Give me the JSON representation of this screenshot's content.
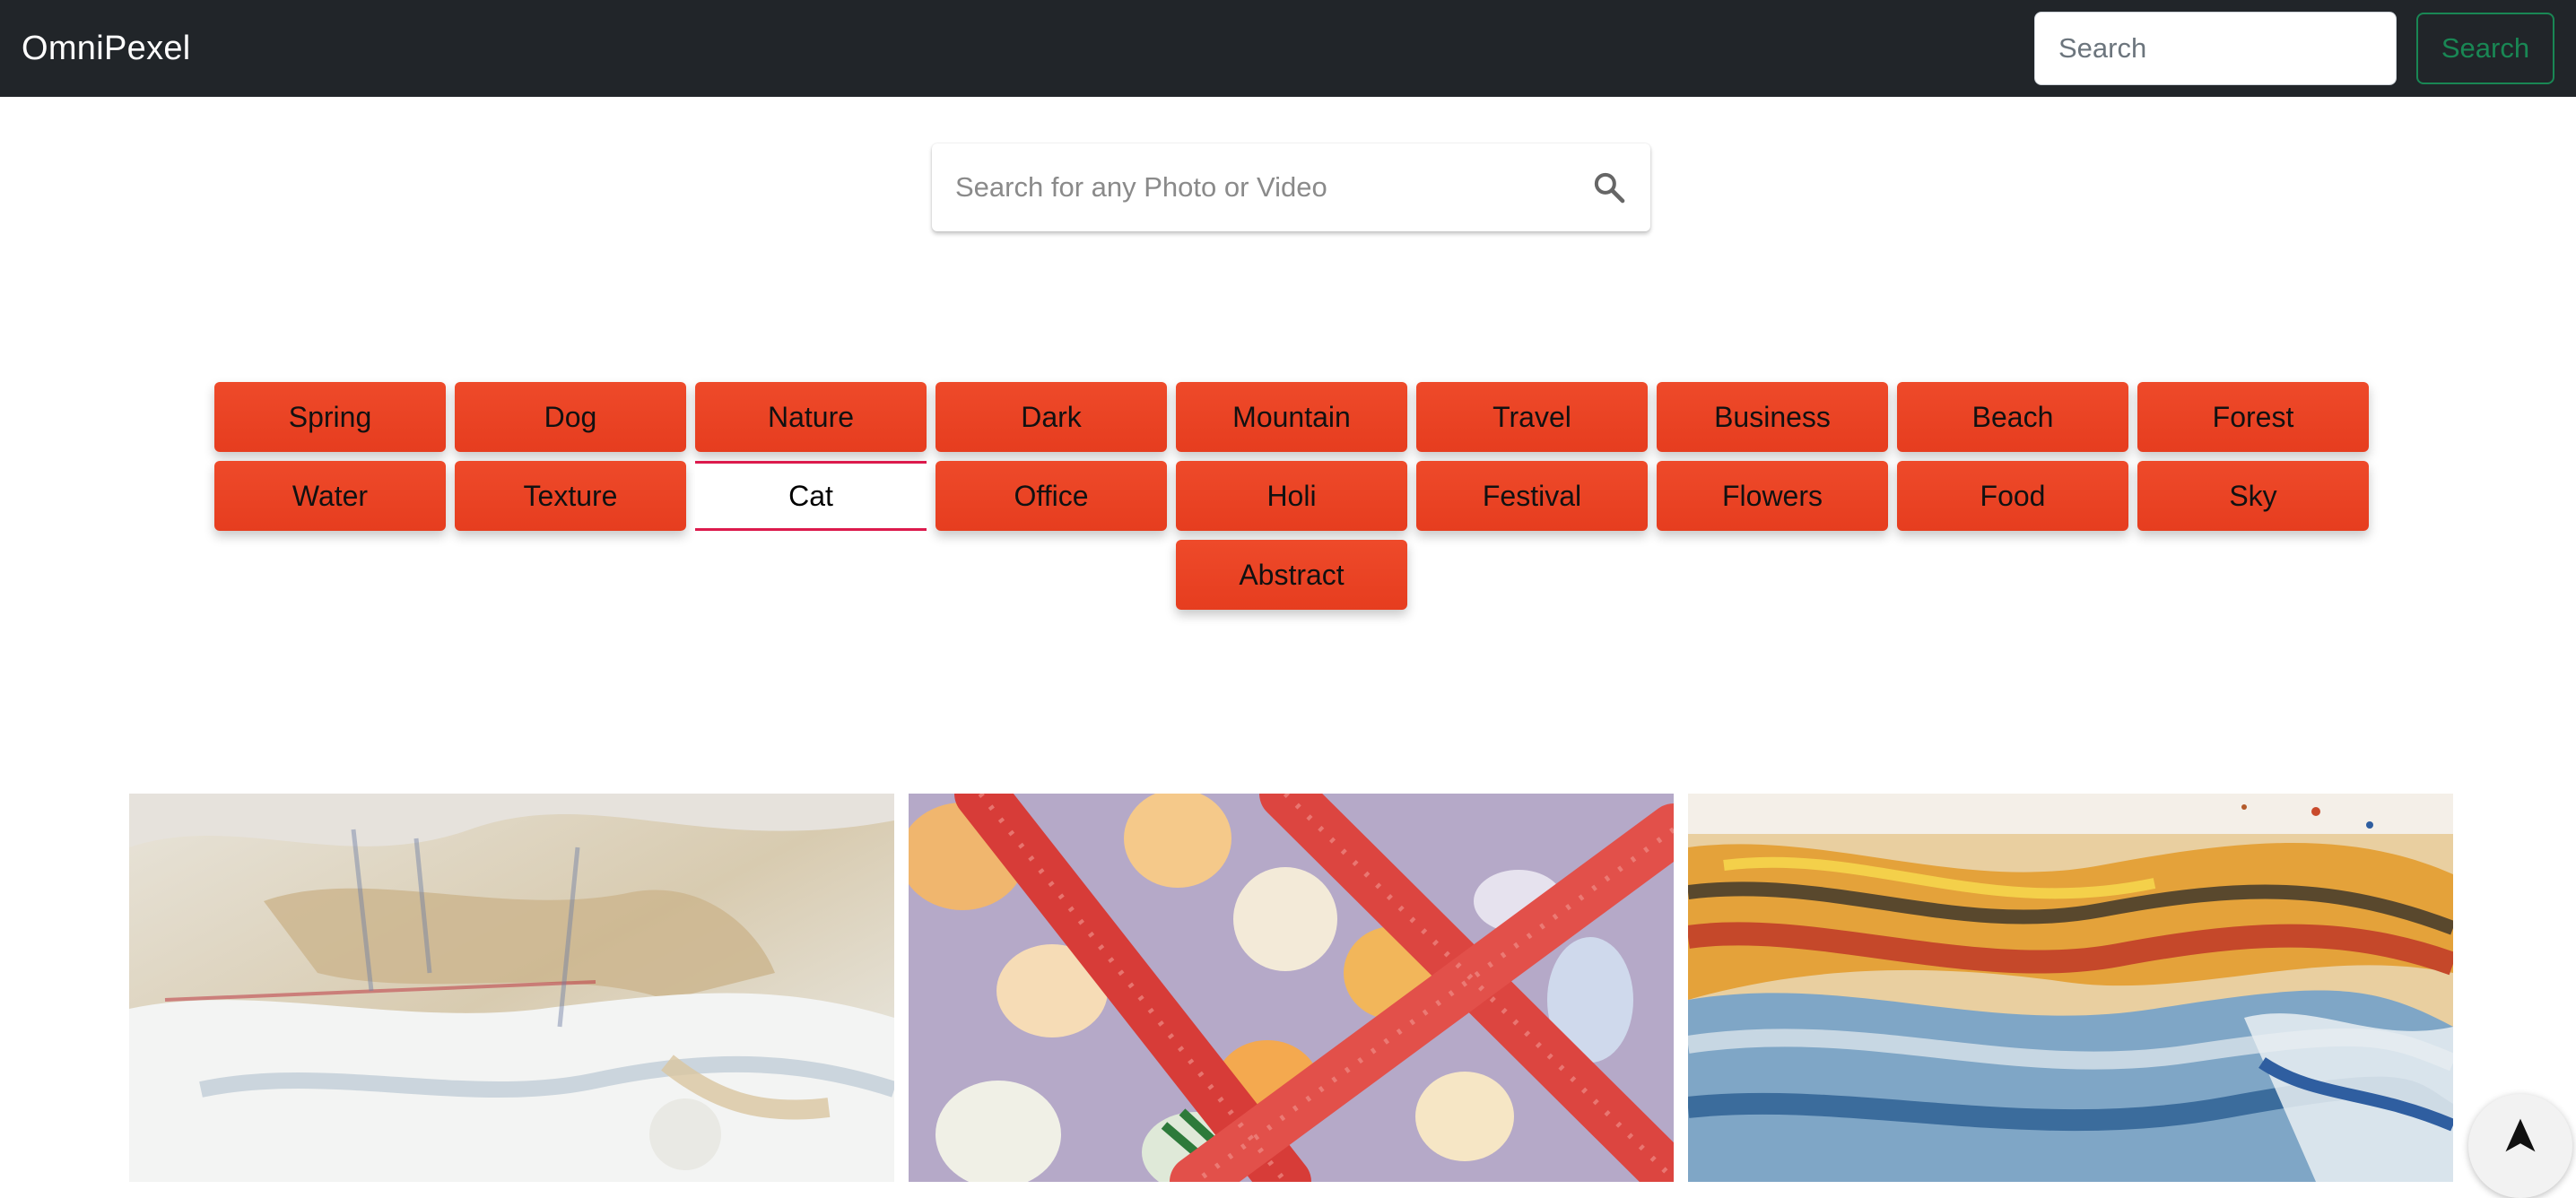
{
  "navbar": {
    "brand": "OmniPexel",
    "search_placeholder": "Search",
    "search_button": "Search"
  },
  "main_search": {
    "placeholder": "Search for any Photo or Video",
    "icon": "search-icon"
  },
  "categories": [
    "Spring",
    "Dog",
    "Nature",
    "Dark",
    "Mountain",
    "Travel",
    "Business",
    "Beach",
    "Forest",
    "Water",
    "Texture",
    "Cat",
    "Office",
    "Holi",
    "Festival",
    "Flowers",
    "Food",
    "Sky",
    "Abstract"
  ],
  "active_category": "Cat",
  "colors": {
    "navbar_bg": "#212529",
    "category_bg": "#e8411f",
    "active_underline": "#dc1a4c",
    "search_button": "#198754"
  },
  "back_to_top": {
    "icon": "navigation-arrow-icon"
  }
}
